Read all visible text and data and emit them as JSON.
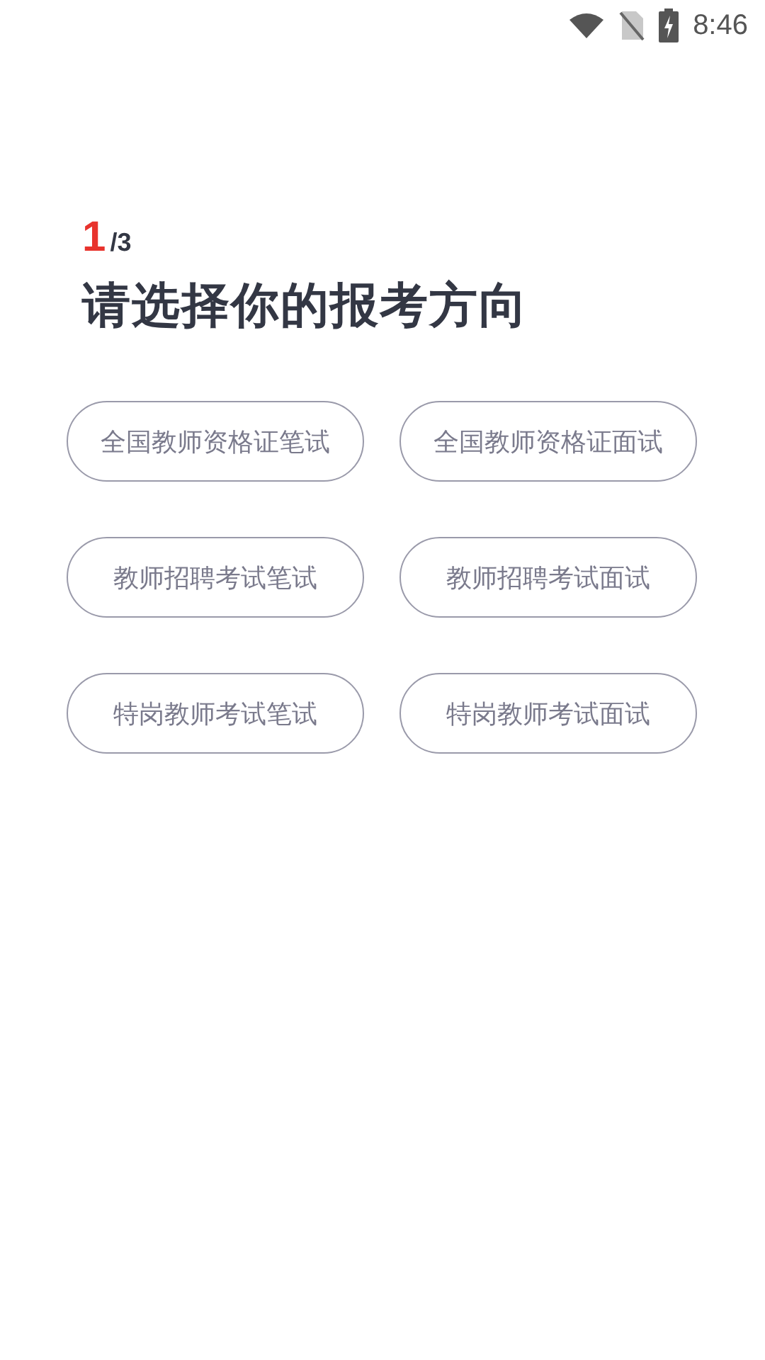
{
  "status_bar": {
    "time": "8:46"
  },
  "step": {
    "current": "1",
    "total": "/3"
  },
  "title": "请选择你的报考方向",
  "options": [
    {
      "label": "全国教师资格证笔试",
      "selected": false
    },
    {
      "label": "全国教师资格证面试",
      "selected": false
    },
    {
      "label": "教师招聘考试笔试",
      "selected": false
    },
    {
      "label": "教师招聘考试面试",
      "selected": false
    },
    {
      "label": "特岗教师考试笔试",
      "selected": false
    },
    {
      "label": "特岗教师考试面试",
      "selected": false
    }
  ]
}
